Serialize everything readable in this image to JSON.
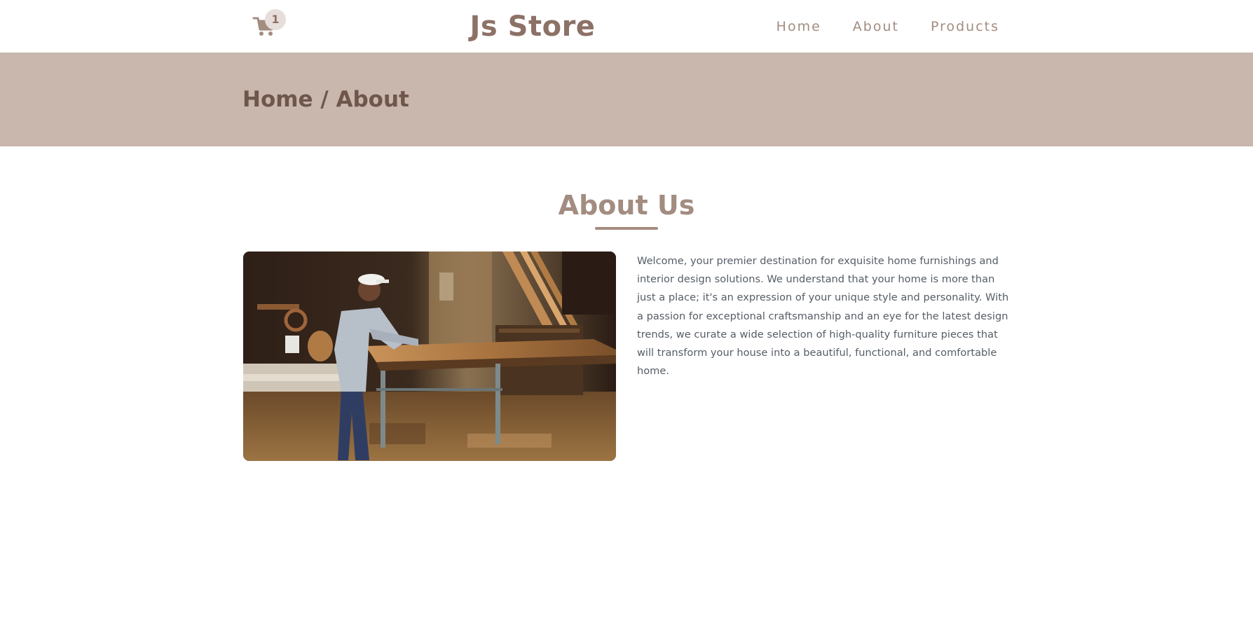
{
  "header": {
    "cart_icon": "shopping-cart-icon",
    "cart_count": "1",
    "brand": "Js Store",
    "nav": [
      {
        "label": "Home"
      },
      {
        "label": "About"
      },
      {
        "label": "Products"
      }
    ]
  },
  "banner": {
    "breadcrumb": "Home / About"
  },
  "about": {
    "title": "About Us",
    "image_icon": "carpenter-workshop-photo",
    "text": "Welcome, your premier destination for exquisite home furnishings and interior design solutions. We understand that your home is more than just a place; it's an expression of your unique style and personality. With a passion for exceptional craftsmanship and an eye for the latest design trends, we curate a wide selection of high-quality furniture pieces that will transform your house into a beautiful, functional, and comfortable home."
  },
  "colors": {
    "brand": "#8c7166",
    "accent": "#a38c80",
    "banner_bg": "#c9b6ad",
    "breadcrumb_text": "#6e564b",
    "body_text": "#555d66"
  }
}
